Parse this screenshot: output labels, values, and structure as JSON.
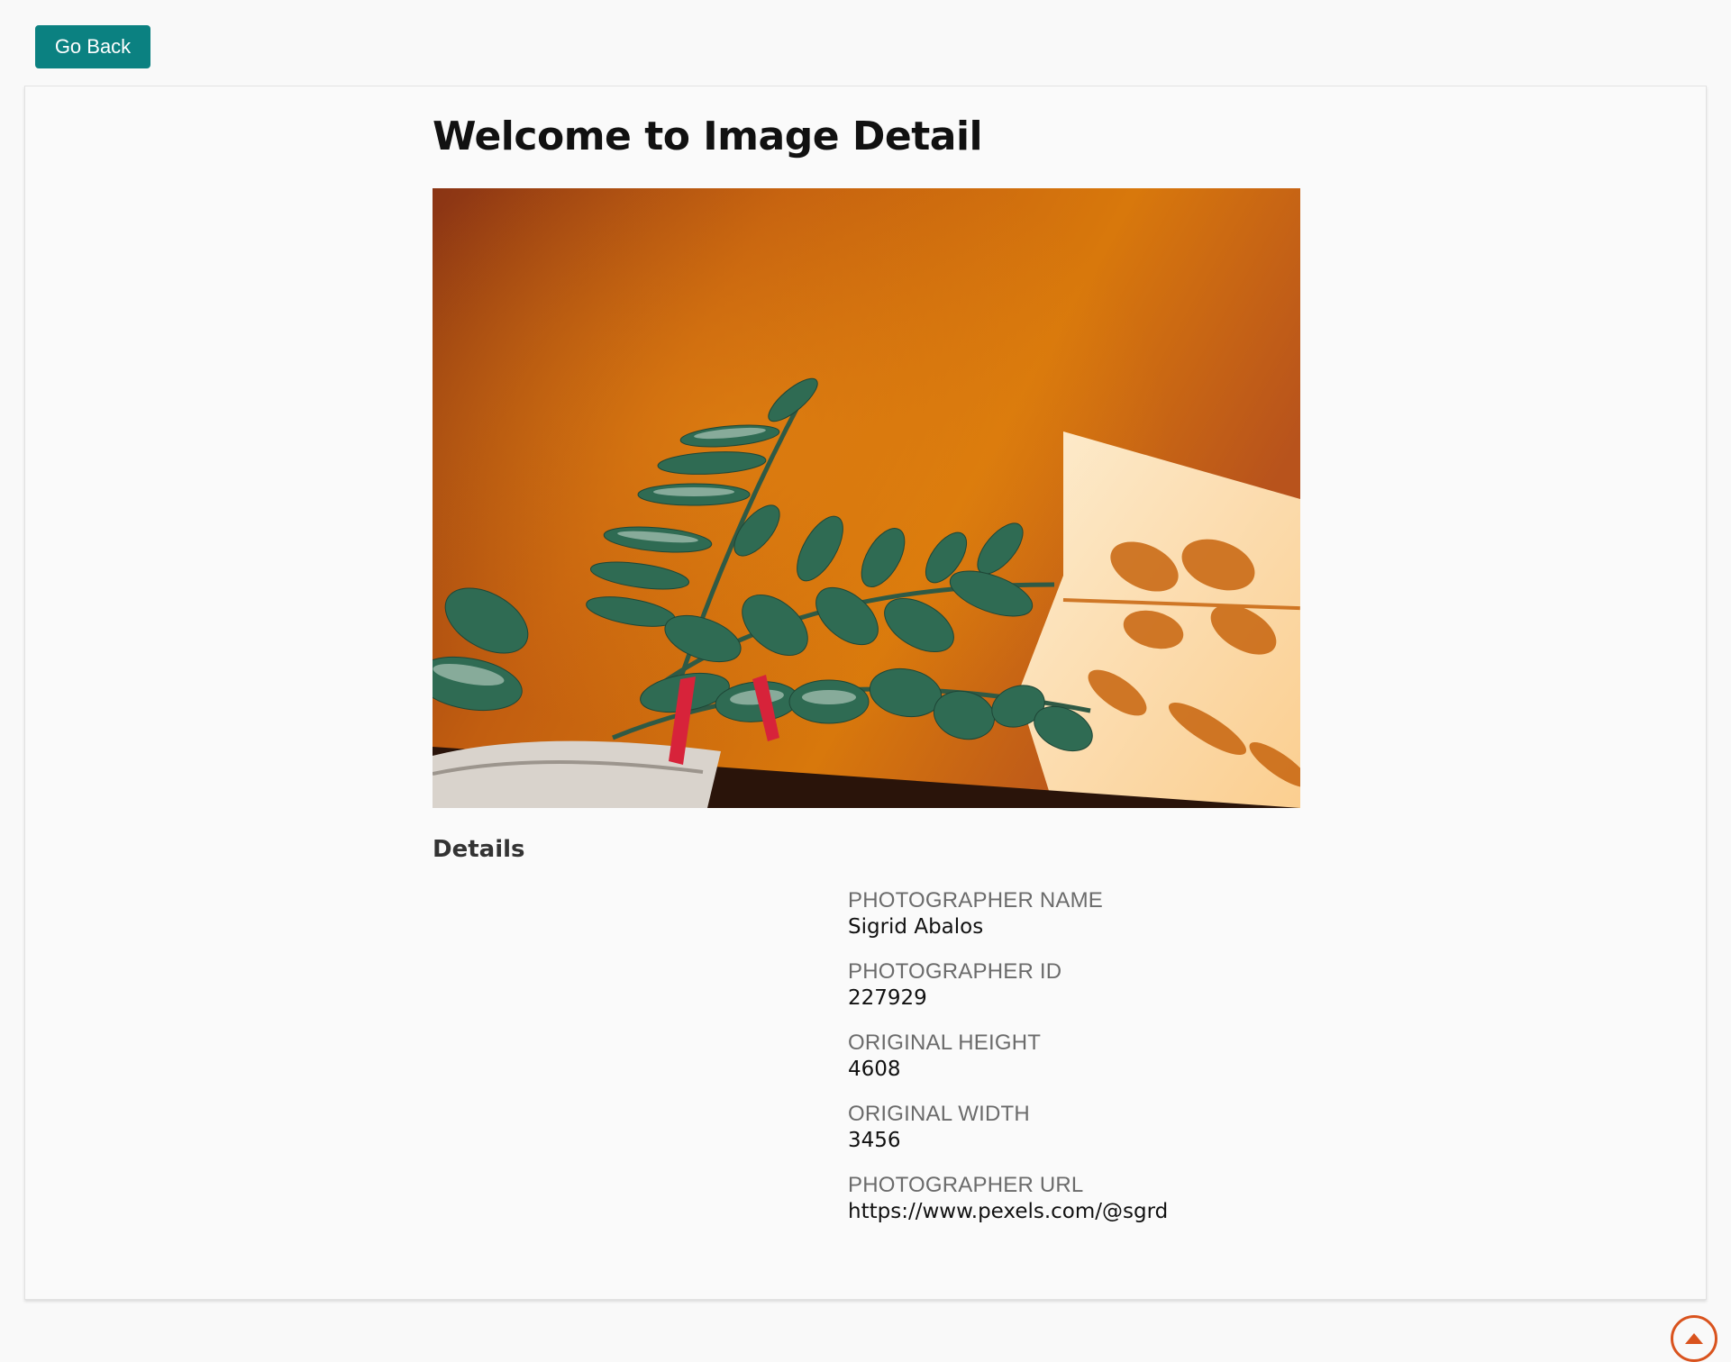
{
  "nav": {
    "back_label": "Go Back"
  },
  "page": {
    "title": "Welcome to Image Detail"
  },
  "image": {
    "subject": "potted plant leaves casting shadow on orange wall"
  },
  "details": {
    "heading": "Details",
    "items": [
      {
        "label": "PHOTOGRAPHER NAME",
        "value": "Sigrid Abalos"
      },
      {
        "label": "PHOTOGRAPHER ID",
        "value": "227929"
      },
      {
        "label": "ORIGINAL HEIGHT",
        "value": "4608"
      },
      {
        "label": "ORIGINAL WIDTH",
        "value": "3456"
      },
      {
        "label": "PHOTOGRAPHER URL",
        "value": "https://www.pexels.com/@sgrd"
      }
    ]
  },
  "scroll_top": {
    "icon": "arrow-up-circle-icon"
  },
  "colors": {
    "primary_button": "#0b8181",
    "scroll_accent": "#d9531e",
    "background": "#f9f9f9"
  }
}
